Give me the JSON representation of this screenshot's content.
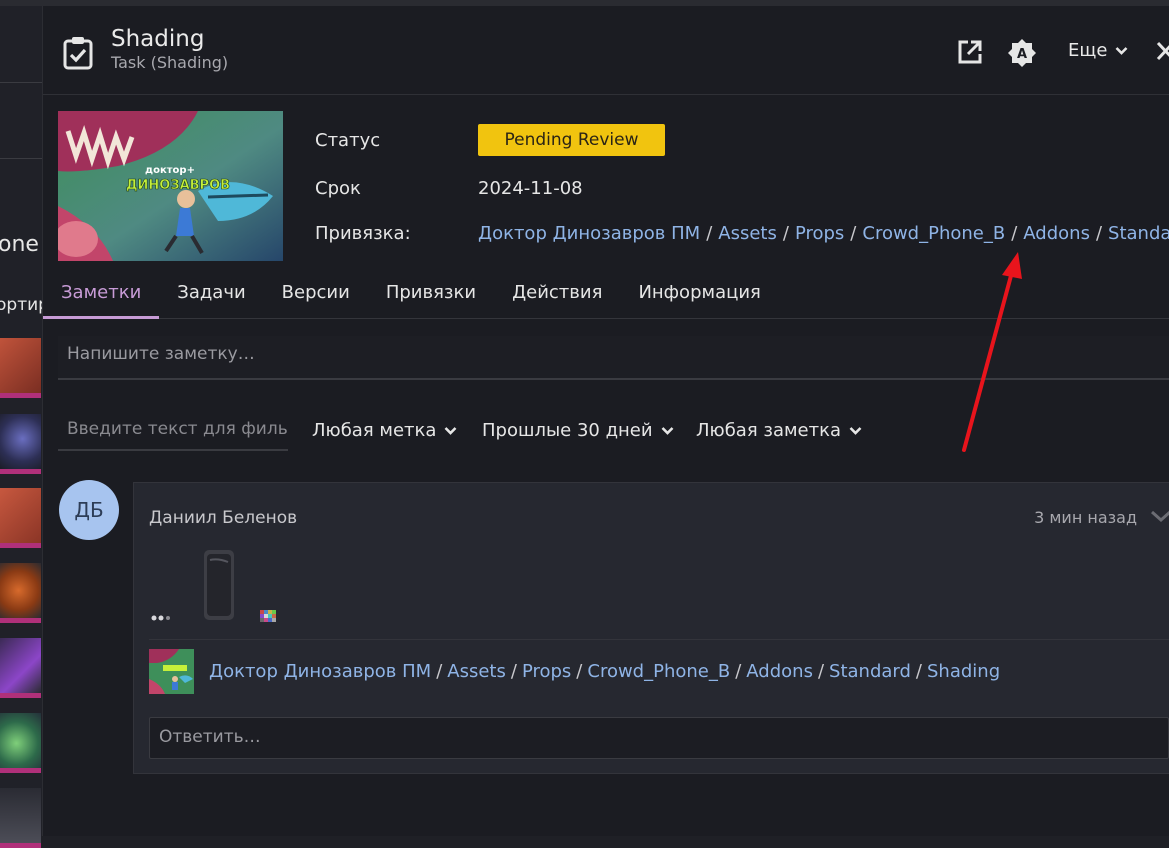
{
  "background": {
    "fragment_1": "one",
    "fragment_2": "ортир"
  },
  "header": {
    "title": "Shading",
    "subtitle": "Task (Shading)",
    "more_label": "Еще"
  },
  "preview": {
    "logo_line1": "доктор+",
    "logo_line2": "ДИНОЗАВРОВ"
  },
  "details": {
    "status_label": "Статус",
    "status_value": "Pending Review",
    "due_label": "Срок",
    "due_value": "2024-11-08",
    "link_label": "Привязка:",
    "breadcrumb": [
      "Доктор Динозавров ПМ",
      "Assets",
      "Props",
      "Crowd_Phone_B",
      "Addons",
      "Standard"
    ]
  },
  "tabs": [
    "Заметки",
    "Задачи",
    "Версии",
    "Привязки",
    "Действия",
    "Информация"
  ],
  "note": {
    "placeholder": "Напишите заметку…"
  },
  "filters": {
    "search_placeholder": "Введите текст для филь",
    "tag": "Любая метка",
    "period": "Прошлые 30 дней",
    "note_type": "Любая заметка"
  },
  "comment": {
    "avatar_initials": "ДБ",
    "author": "Даниил Беленов",
    "time": "3 мин назад",
    "breadcrumb": [
      "Доктор Динозавров ПМ",
      "Assets",
      "Props",
      "Crowd_Phone_B",
      "Addons",
      "Standard",
      "Shading"
    ],
    "reply_placeholder": "Ответить…"
  },
  "colors": {
    "status": "#f1c40f",
    "link": "#8fb4e6",
    "active_tab": "#c79bd6",
    "annotation_arrow": "#e8141c"
  }
}
